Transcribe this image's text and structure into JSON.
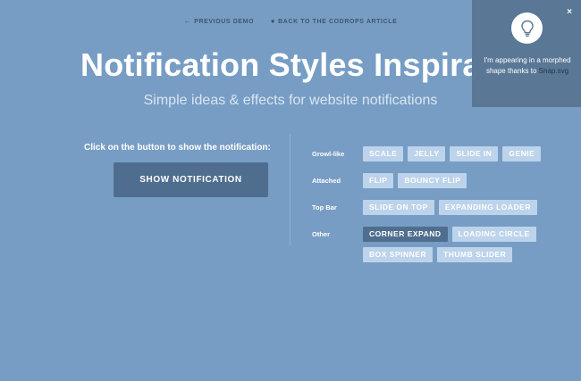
{
  "nav": {
    "previous_demo": "PREVIOUS DEMO",
    "back_to_article": "BACK TO THE CODROPS ARTICLE"
  },
  "header": {
    "title": "Notification Styles Inspirati",
    "subtitle": "Simple ideas & effects for website notifications"
  },
  "main": {
    "instruction": "Click on the button to show the notification:",
    "show_button": "SHOW NOTIFICATION"
  },
  "styles": [
    {
      "category": "Growl-like",
      "options": [
        "SCALE",
        "JELLY",
        "SLIDE IN",
        "GENIE"
      ]
    },
    {
      "category": "Attached",
      "options": [
        "FLIP",
        "BOUNCY FLIP"
      ]
    },
    {
      "category": "Top Bar",
      "options": [
        "SLIDE ON TOP",
        "EXPANDING LOADER"
      ]
    },
    {
      "category": "Other",
      "options": [
        "CORNER EXPAND",
        "LOADING CIRCLE",
        "BOX SPINNER",
        "THUMB SLIDER"
      ]
    }
  ],
  "selected_style": "CORNER EXPAND",
  "notification": {
    "close_label": "×",
    "message_part1": "I'm appearing in a morphed shape thanks to",
    "message_link": "Snap.svg",
    "icon": "lightbulb-icon"
  },
  "colors": {
    "background": "#779dc4",
    "button_dark": "#4f6e8f",
    "chip": "#bcd3eb",
    "notification_bg": "#5a7896"
  }
}
